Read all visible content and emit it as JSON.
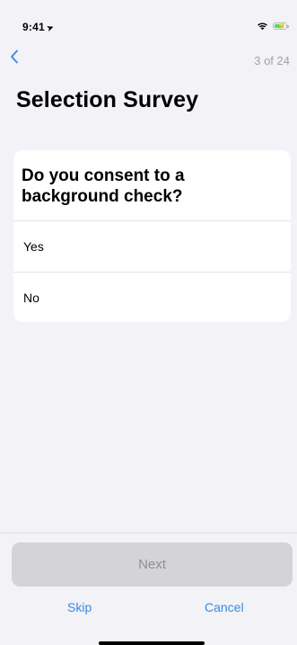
{
  "status_bar": {
    "time": "9:41",
    "location_arrow": "location-arrow-icon",
    "wifi": "wifi-icon",
    "battery_level": 0.85,
    "battery_charging": true
  },
  "nav": {
    "back_icon": "chevron-left-icon",
    "step_counter": "3 of 24"
  },
  "page": {
    "title": "Selection Survey"
  },
  "question": {
    "text": "Do you consent to a background check?",
    "options": [
      {
        "label": "Yes"
      },
      {
        "label": "No"
      }
    ]
  },
  "footer": {
    "next_label": "Next",
    "skip_label": "Skip",
    "cancel_label": "Cancel"
  },
  "colors": {
    "background": "#f2f2f7",
    "accent": "#3a8ae0",
    "disabled_button": "#d3d3d8",
    "disabled_text": "#8f8f96",
    "battery_green": "#4cd964"
  }
}
